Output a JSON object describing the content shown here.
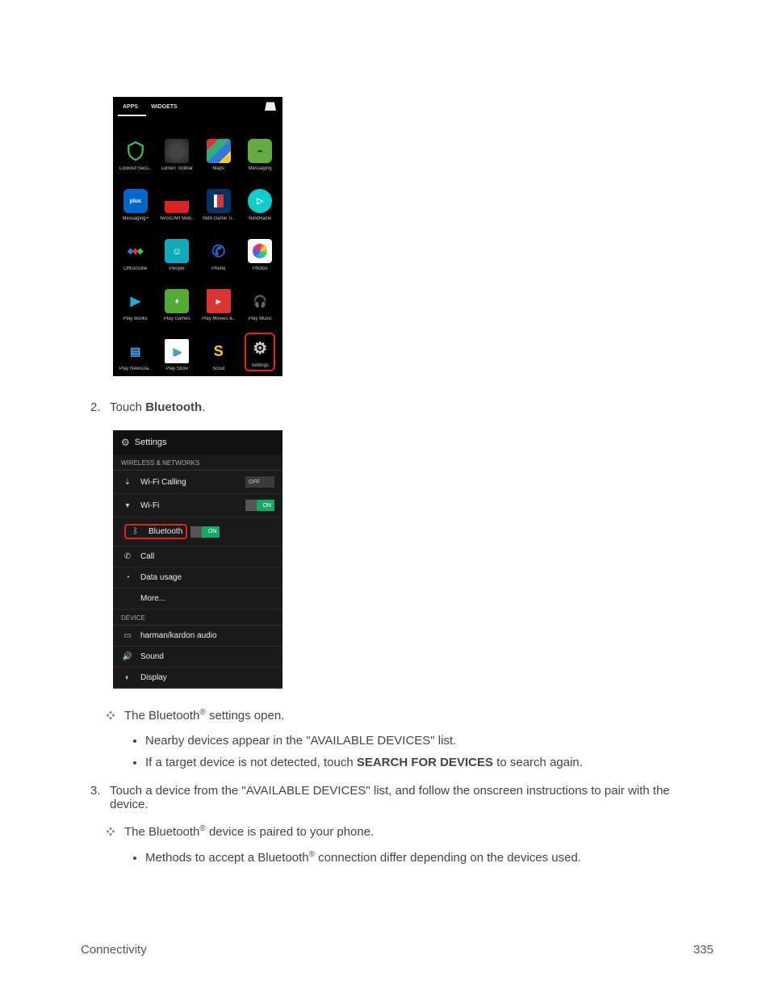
{
  "apps_header": {
    "tab_apps": "APPS",
    "tab_widgets": "WIDGETS"
  },
  "apps": [
    {
      "label": "Lookout Secu..",
      "cls": "ic-lookout"
    },
    {
      "label": "Lumen Toolbar",
      "cls": "ic-lumen"
    },
    {
      "label": "Maps",
      "cls": "ic-maps"
    },
    {
      "label": "Messaging",
      "cls": "ic-messaging"
    },
    {
      "label": "Messaging+",
      "cls": "ic-messagingplus",
      "txt": "plus"
    },
    {
      "label": "NASCAR Mob..",
      "cls": "ic-nascar"
    },
    {
      "label": "NBA Game Ti..",
      "cls": "ic-nba"
    },
    {
      "label": "NextRadio",
      "cls": "ic-nextradio"
    },
    {
      "label": "OfficeSuite",
      "cls": "ic-office"
    },
    {
      "label": "People",
      "cls": "ic-people"
    },
    {
      "label": "Phone",
      "cls": "ic-phone",
      "txt": "✆"
    },
    {
      "label": "Photos",
      "cls": "ic-photos"
    },
    {
      "label": "Play Books",
      "cls": "ic-playbooks"
    },
    {
      "label": "Play Games",
      "cls": "ic-playgames"
    },
    {
      "label": "Play Movies &..",
      "cls": "ic-playmovies"
    },
    {
      "label": "Play Music",
      "cls": "ic-playmusic"
    },
    {
      "label": "Play Newssta..",
      "cls": "ic-playnews"
    },
    {
      "label": "Play Store",
      "cls": "ic-playstore"
    },
    {
      "label": "Scout",
      "cls": "ic-scout",
      "txt": "S"
    },
    {
      "label": "Settings",
      "cls": "ic-settings",
      "highlight": true
    }
  ],
  "step2": {
    "num": "2.",
    "pre": "Touch ",
    "bold": "Bluetooth",
    "post": "."
  },
  "settings": {
    "title": "Settings",
    "section1": "WIRELESS & NETWORKS",
    "rows1": [
      {
        "icon": "wc",
        "label": "Wi-Fi Calling",
        "toggle": "OFF"
      },
      {
        "icon": "wf",
        "label": "Wi-Fi",
        "toggle": "ON"
      },
      {
        "icon": "bt",
        "label": "Bluetooth",
        "toggle": "ON",
        "highlight": true
      },
      {
        "icon": "ph",
        "label": "Call"
      },
      {
        "icon": "du",
        "label": "Data usage"
      },
      {
        "indent": true,
        "label": "More..."
      }
    ],
    "section2": "DEVICE",
    "rows2": [
      {
        "icon": "hk",
        "label": "harman/kardon audio"
      },
      {
        "icon": "sd",
        "label": "Sound"
      },
      {
        "icon": "dp",
        "label": "Display"
      }
    ]
  },
  "result1": {
    "pre": "The Bluetooth",
    "sup": "®",
    "post": " settings open."
  },
  "sub1a": "Nearby devices appear in the \"AVAILABLE DEVICES\" list.",
  "sub1b": {
    "pre": "If a target device is not detected, touch ",
    "bold": "SEARCH FOR DEVICES",
    "post": " to search again."
  },
  "step3": {
    "num": "3.",
    "text": "Touch a device from the \"AVAILABLE DEVICES\" list, and follow the onscreen instructions to pair with the device."
  },
  "result2": {
    "pre": "The Bluetooth",
    "sup": "®",
    "post": " device is paired to your phone."
  },
  "sub2a": {
    "pre": "Methods to accept a Bluetooth",
    "sup": "®",
    "post": " connection differ depending on the devices used."
  },
  "footer": {
    "left": "Connectivity",
    "right": "335"
  }
}
